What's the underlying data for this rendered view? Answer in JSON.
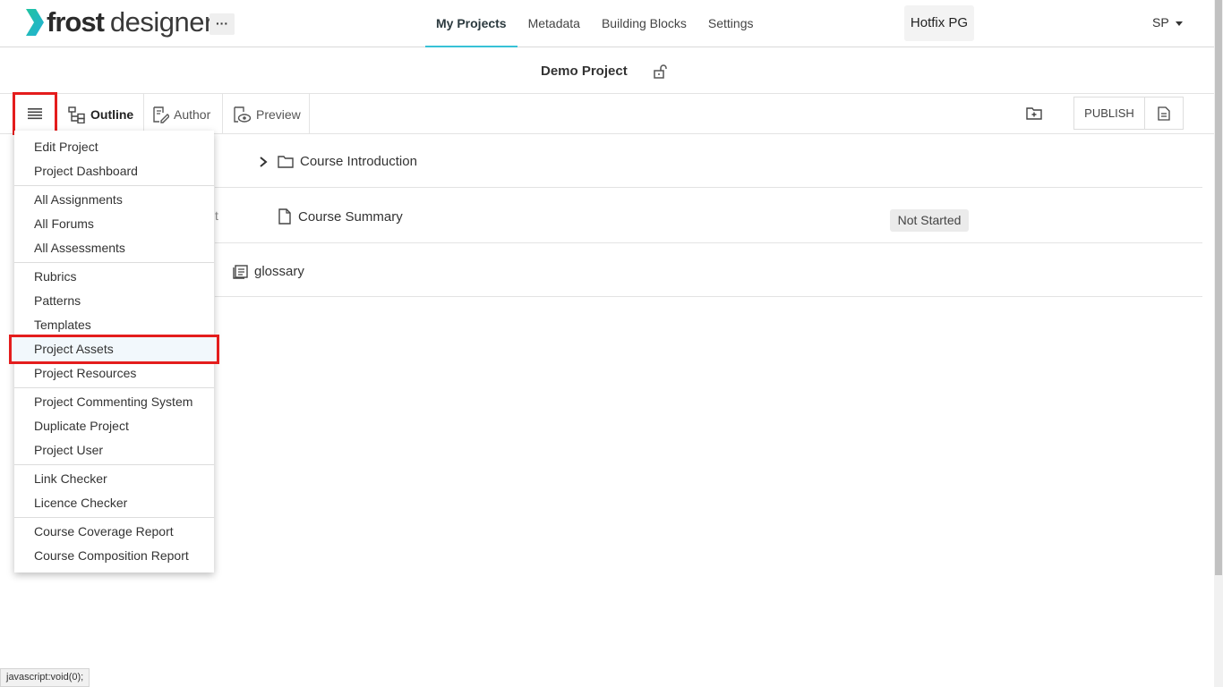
{
  "header": {
    "logo_bold": "frost",
    "logo_light": "designer",
    "more_label": "···",
    "nav": [
      {
        "label": "My Projects",
        "active": true
      },
      {
        "label": "Metadata",
        "active": false
      },
      {
        "label": "Building Blocks",
        "active": false
      },
      {
        "label": "Settings",
        "active": false
      }
    ],
    "org_label": "Hotfix PG",
    "user_initials": "SP"
  },
  "project": {
    "title": "Demo Project"
  },
  "toolbar": {
    "outline_label": "Outline",
    "author_label": "Author",
    "preview_label": "Preview",
    "publish_label": "PUBLISH"
  },
  "outline": {
    "rows": [
      {
        "label": "Course Introduction",
        "icon": "folder-icon"
      },
      {
        "label": "Course Summary",
        "icon": "page-icon",
        "status": "Not Started",
        "hidden_fragment": "t"
      },
      {
        "label": "glossary",
        "icon": "glossary-icon"
      }
    ]
  },
  "menu": {
    "groups": [
      [
        "Edit Project",
        "Project Dashboard"
      ],
      [
        "All Assignments",
        "All Forums",
        "All Assessments"
      ],
      [
        "Rubrics",
        "Patterns",
        "Templates",
        "Project Assets",
        "Project Resources"
      ],
      [
        "Project Commenting System",
        "Duplicate Project",
        "Project User"
      ],
      [
        "Link Checker",
        "Licence Checker"
      ],
      [
        "Course Coverage Report",
        "Course Composition Report"
      ]
    ],
    "highlighted": "Project Assets"
  },
  "status_bar": "javascript:void(0);",
  "colors": {
    "accent": "#37c1d6",
    "logo_green": "#25c28a",
    "highlight_border": "#e41d1d"
  }
}
